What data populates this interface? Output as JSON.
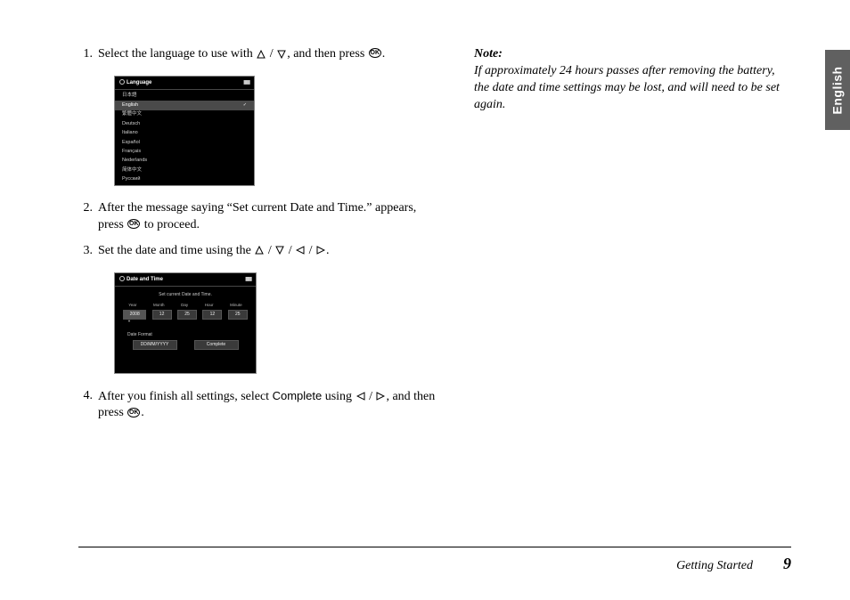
{
  "sideTab": "English",
  "steps": {
    "s1": {
      "num": "1.",
      "a": "Select the language to use with ",
      "b": ", and then press ",
      "c": "."
    },
    "s2": {
      "num": "2.",
      "a": "After the message saying “Set current Date and Time.” appears, press ",
      "b": " to proceed."
    },
    "s3": {
      "num": "3.",
      "a": "Set the date and time using the ",
      "b": "."
    },
    "s4": {
      "num": "4.",
      "a": "After you finish all settings, select ",
      "complete": "Complete",
      "b": " using ",
      "c": ", and then press ",
      "d": "."
    }
  },
  "note": {
    "heading": "Note:",
    "body": "If approximately 24 hours passes after removing the battery, the date and time settings may be lost, and will need to be set again."
  },
  "langScreen": {
    "title": "Language",
    "items": [
      "日本語",
      "English",
      "繁體中文",
      "Deutsch",
      "Italiano",
      "Español",
      "Français",
      "Nederlands",
      "简体中文",
      "Русский"
    ]
  },
  "dtScreen": {
    "title": "Date and Time",
    "msg": "Set current Date and Time.",
    "labels": [
      "Year",
      "Month",
      "Day",
      "Hour",
      "Minute"
    ],
    "values": [
      "2008",
      "12",
      "25",
      "12",
      "25"
    ],
    "dfLabel": "Date Format",
    "df": "DD/MM/YYYY",
    "complete": "Complete"
  },
  "footer": {
    "section": "Getting Started",
    "page": "9"
  }
}
